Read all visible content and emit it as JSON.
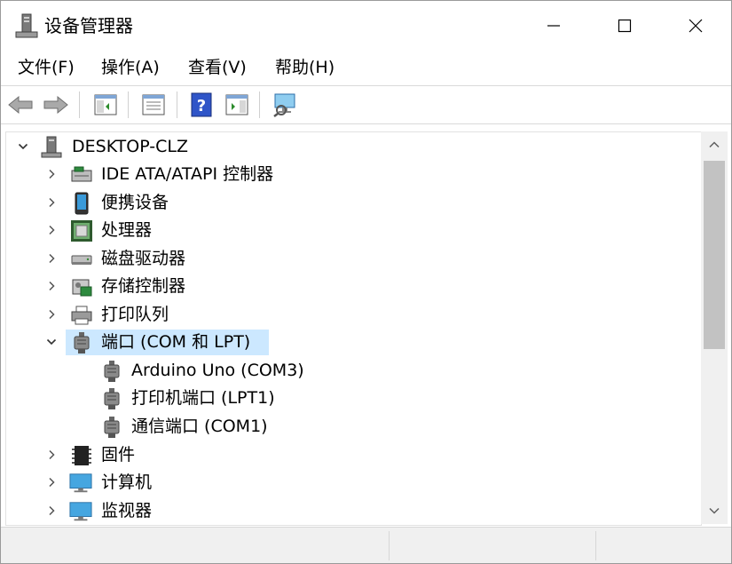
{
  "window": {
    "title": "设备管理器",
    "controls": {
      "minimize": "minimize",
      "maximize": "maximize",
      "close": "close"
    }
  },
  "menu": [
    {
      "label": "文件(F)"
    },
    {
      "label": "操作(A)"
    },
    {
      "label": "查看(V)"
    },
    {
      "label": "帮助(H)"
    }
  ],
  "toolbar": {
    "icons": [
      "back-arrow-icon",
      "forward-arrow-icon",
      "console-tree-icon",
      "properties-icon",
      "help-icon",
      "action-pane-icon",
      "scan-hardware-icon"
    ]
  },
  "tree": {
    "root": {
      "label": "DESKTOP-CLZ",
      "icon": "computer-tower-icon",
      "expanded": true
    },
    "items": [
      {
        "label": "IDE ATA/ATAPI 控制器",
        "icon": "ide-controller-icon",
        "expanded": false
      },
      {
        "label": "便携设备",
        "icon": "portable-device-icon",
        "expanded": false
      },
      {
        "label": "处理器",
        "icon": "processor-icon",
        "expanded": false
      },
      {
        "label": "磁盘驱动器",
        "icon": "disk-drive-icon",
        "expanded": false
      },
      {
        "label": "存储控制器",
        "icon": "storage-controller-icon",
        "expanded": false
      },
      {
        "label": "打印队列",
        "icon": "printer-icon",
        "expanded": false
      },
      {
        "label": "端口 (COM 和 LPT)",
        "icon": "port-icon",
        "expanded": true,
        "selected": true,
        "children": [
          {
            "label": "Arduino Uno (COM3)",
            "icon": "port-icon"
          },
          {
            "label": "打印机端口 (LPT1)",
            "icon": "port-icon"
          },
          {
            "label": "通信端口 (COM1)",
            "icon": "port-icon"
          }
        ]
      },
      {
        "label": "固件",
        "icon": "firmware-chip-icon",
        "expanded": false
      },
      {
        "label": "计算机",
        "icon": "computer-monitor-icon",
        "expanded": false
      },
      {
        "label": "监视器",
        "icon": "monitor-icon",
        "expanded": false
      }
    ]
  },
  "colors": {
    "selection": "#cce8ff",
    "scrollbar_thumb": "#c2c2c2",
    "status_bar": "#f0f0f0"
  }
}
